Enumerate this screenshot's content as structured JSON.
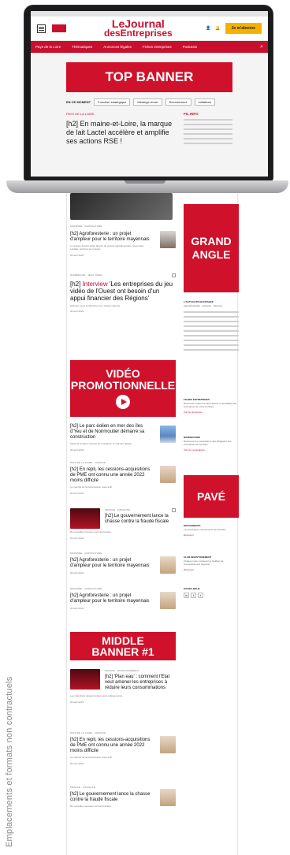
{
  "caption": "Emplacements et formats non contractuels",
  "header": {
    "logo_line1": "LeJournal",
    "logo_line2": "desEntreprises",
    "subscribe": "Je m'abonne"
  },
  "nav": {
    "region": "Pays de la Loire",
    "items": [
      "Thématiques",
      "Annonces légales",
      "Fiches entreprises",
      "Podcasts"
    ]
  },
  "laptop_screen": {
    "top_banner": "TOP BANNER",
    "now_label": "EN CE MOMENT",
    "chips": [
      "Fonction stratégique",
      "Mélange-école",
      "Recrutement",
      "Initiatives"
    ],
    "lead_kicker": "PAYS DE LA LOIRE",
    "lead_title": "[h2] En maine-et-Loire, la marque de lait Lactel accélère et amplifie ses actions RSE !",
    "sidebar_title": "FIL INFO"
  },
  "ads": {
    "grand_angle": "GRAND ANGLE",
    "video": "VIDÉO PROMOTIONNELLE",
    "pave": "PAVÉ",
    "middle": "MIDDLE BANNER #1"
  },
  "articles": [
    {
      "prefix": "[h2]",
      "highlight": "",
      "title": "Agroforesterie : un projet d'ampleur pour le territoire mayennais",
      "meta": "MAYENNE · AGRICULTURE",
      "excerpt": "Le groupe de lait Lactel, fleuron du groupe agroalimentaire mayennais Lactalis, renforce son impact.",
      "date": "26 avril 2023"
    },
    {
      "prefix": "[h2]",
      "highlight": "Interview",
      "title": "'Les entreprises du jeu vidéo de l'Ouest ont besoin d'un appui financier des Régions'",
      "meta": "NUMÉRIQUE · JEUX VIDÉO",
      "excerpt": "Entretien avec la directrice d'un cluster régional.",
      "date": "26 avril 2023"
    },
    {
      "prefix": "[h2]",
      "highlight": "",
      "title": "Le parc éolien en mer des îles d'Yeu et de Noirmoutier démarre sa construction",
      "meta": "VENDÉE · ÉNERGIE",
      "excerpt": "Après de longues années de procédure, le chantier débute.",
      "date": "26 avril 2023"
    },
    {
      "prefix": "[h2]",
      "highlight": "",
      "title": "En repli, les cessions-acquisitions de PME ont connu une année 2022 moins difficile",
      "meta": "PAYS DE LA LOIRE · FINANCE",
      "excerpt": "Le marché de la transmission reste actif.",
      "date": "26 avril 2023"
    },
    {
      "prefix": "[h2]",
      "highlight": "",
      "title": "Le gouvernement lance la chasse contre la fraude fiscale",
      "meta": "FRANCE · FISCALITÉ",
      "excerpt": "De nouvelles mesures sont annoncées.",
      "date": "26 avril 2023"
    },
    {
      "prefix": "[h2]",
      "highlight": "",
      "title": "Agroforesterie : un projet d'ampleur pour le territoire mayennais",
      "meta": "MAYENNE · AGRICULTURE",
      "excerpt": "Le groupe de lait Lactel renforce son impact.",
      "date": "26 avril 2023"
    },
    {
      "prefix": "[h2]",
      "highlight": "",
      "title": "Agroforesterie : un projet d'ampleur pour le territoire mayennais",
      "meta": "MAYENNE · AGRICULTURE",
      "excerpt": "Le groupe de lait Lactel renforce son impact.",
      "date": "26 avril 2023"
    },
    {
      "prefix": "[h2]",
      "highlight": "",
      "title": "'Plan eau' : comment l'Etat veut amener les entreprises à réduire leurs consommations",
      "meta": "FRANCE · ENVIRONNEMENT",
      "excerpt": "Les industriels doivent réduire leurs prélèvements.",
      "date": "26 avril 2023"
    },
    {
      "prefix": "[h2]",
      "highlight": "",
      "title": "En repli, les cessions-acquisitions de PME ont connu une année 2022 moins difficile",
      "meta": "PAYS DE LA LOIRE · FINANCE",
      "excerpt": "Le marché de la transmission reste actif.",
      "date": "26 avril 2023"
    },
    {
      "prefix": "[h2]",
      "highlight": "",
      "title": "Le gouvernement lance la chasse contre la fraude fiscale",
      "meta": "FRANCE · FISCALITÉ",
      "excerpt": "De nouvelles mesures sont annoncées.",
      "date": "26 avril 2023"
    }
  ],
  "sidebar": {
    "section1_title": "L'ACTUALITÉ EN FRANCE",
    "section1_text": "Agroalimentaire · Industrie · Services",
    "box1_title": "FICHES ENTREPRISES",
    "box1_text": "Retrouvez toutes les informations et actualités des entreprises de votre territoire.",
    "box1_link": "Voir les annonces",
    "box2_title": "NOMINATIONS",
    "box2_text": "Retrouvez les nominations des dirigeants des entreprises du territoire.",
    "box2_link": "Voir les nominations",
    "box3_title": "MOUVEMENTS",
    "box3_text": "Les principaux mouvements de direction.",
    "box3_link": "Découvrir",
    "box4_title": "CLUB INVESTISSEMENT",
    "box4_text": "Chaque mois, retrouvez le meilleur de l'investissement régional.",
    "box4_link": "Découvrir",
    "follow": "SUIVEZ-NOUS"
  }
}
